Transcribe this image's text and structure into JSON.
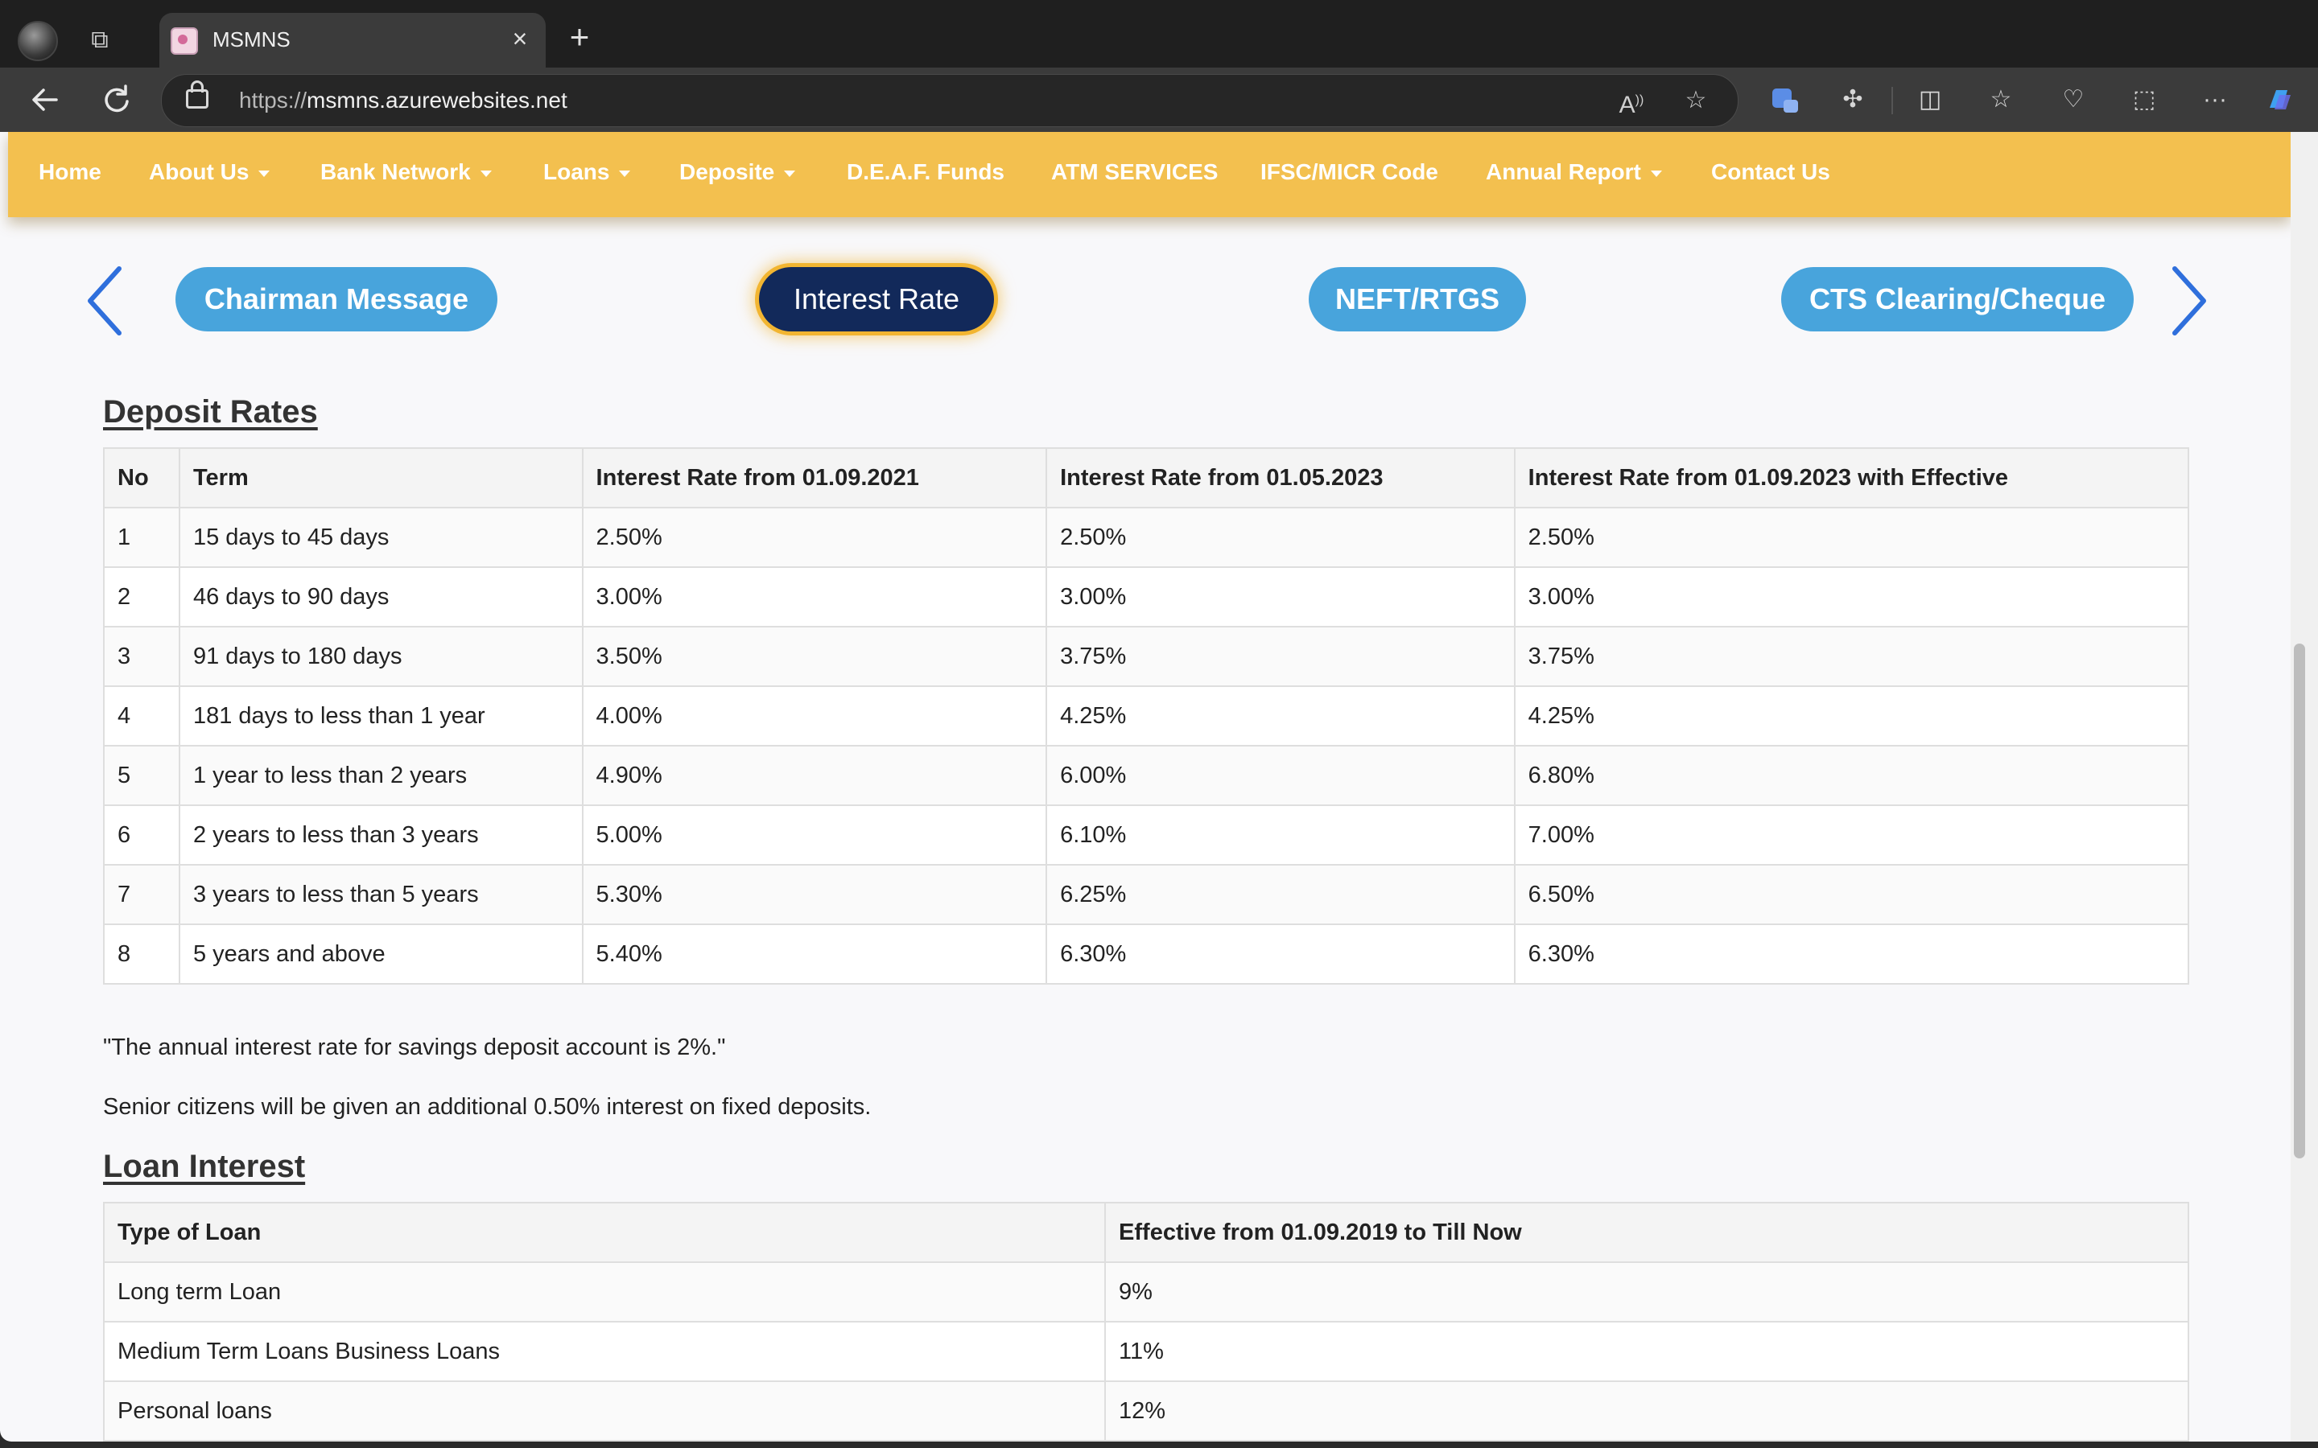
{
  "browser": {
    "tab_title": "MSMNS",
    "url_scheme": "https://",
    "url_host": "msmns.azurewebsites.net"
  },
  "nav": {
    "items": [
      {
        "label": "Home",
        "dropdown": false
      },
      {
        "label": "About Us",
        "dropdown": true
      },
      {
        "label": "Bank Network",
        "dropdown": true
      },
      {
        "label": "Loans",
        "dropdown": true
      },
      {
        "label": "Deposite",
        "dropdown": true
      },
      {
        "label": "D.E.A.F. Funds",
        "dropdown": false
      },
      {
        "label": "ATM SERVICES",
        "dropdown": false
      },
      {
        "label": "IFSC/MICR Code",
        "dropdown": false
      },
      {
        "label": "Annual Report",
        "dropdown": true
      },
      {
        "label": "Contact Us",
        "dropdown": false
      }
    ]
  },
  "carousel": {
    "pills": [
      {
        "label": "Chairman Message",
        "active": false
      },
      {
        "label": "Interest Rate",
        "active": true
      },
      {
        "label": "NEFT/RTGS",
        "active": false
      },
      {
        "label": "CTS Clearing/Cheque",
        "active": false
      }
    ]
  },
  "deposit": {
    "title": "Deposit Rates",
    "headers": [
      "No",
      "Term",
      "Interest Rate from 01.09.2021",
      "Interest Rate from 01.05.2023",
      "Interest Rate from 01.09.2023 with Effective"
    ],
    "rows": [
      [
        "1",
        "15 days to 45 days",
        "2.50%",
        "2.50%",
        "2.50%"
      ],
      [
        "2",
        "46 days to 90 days",
        "3.00%",
        "3.00%",
        "3.00%"
      ],
      [
        "3",
        "91 days to 180 days",
        "3.50%",
        "3.75%",
        "3.75%"
      ],
      [
        "4",
        "181 days to less than 1 year",
        "4.00%",
        "4.25%",
        "4.25%"
      ],
      [
        "5",
        "1 year to less than 2 years",
        "4.90%",
        "6.00%",
        "6.80%"
      ],
      [
        "6",
        "2 years to less than 3 years",
        "5.00%",
        "6.10%",
        "7.00%"
      ],
      [
        "7",
        "3 years to less than 5 years",
        "5.30%",
        "6.25%",
        "6.50%"
      ],
      [
        "8",
        "5 years and above",
        "5.40%",
        "6.30%",
        "6.30%"
      ]
    ],
    "note_savings": "\"The annual interest rate for savings deposit account is 2%.\"",
    "note_senior": "Senior citizens will be given an additional 0.50% interest on fixed deposits."
  },
  "loan": {
    "title": "Loan Interest",
    "headers": [
      "Type of Loan",
      "Effective from 01.09.2019 to Till Now"
    ],
    "rows": [
      [
        "Long term Loan",
        "9%"
      ],
      [
        "Medium Term Loans Business Loans",
        "11%"
      ],
      [
        "Personal loans",
        "12%"
      ]
    ]
  },
  "colors": {
    "navbar": "#f3c04f",
    "pill": "#48a4dc",
    "pill_active": "#12295a",
    "pill_active_glow": "#f2b531",
    "arrow": "#2f6fdc"
  },
  "icons": {
    "back": "back-arrow-icon",
    "refresh": "refresh-icon",
    "lock": "lock-icon",
    "prev": "chevron-left-icon",
    "next": "chevron-right-icon"
  }
}
